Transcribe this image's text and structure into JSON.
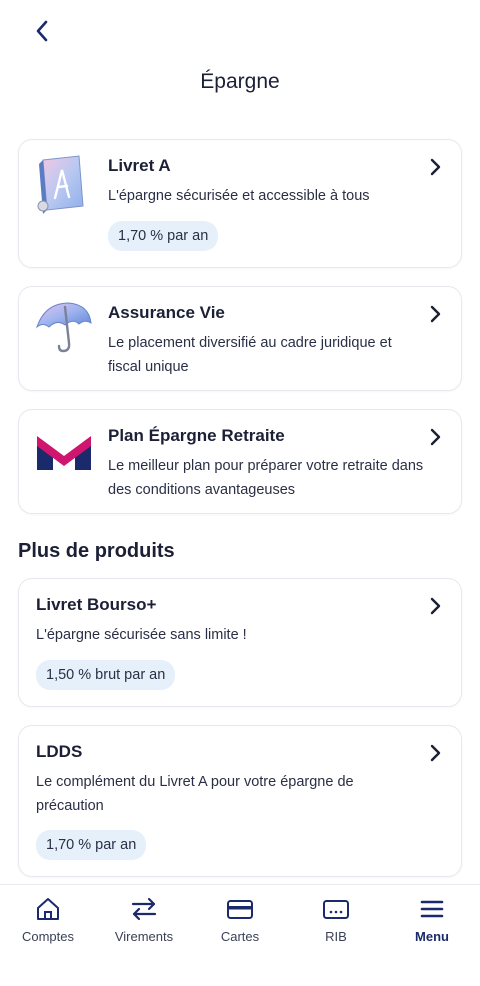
{
  "header": {
    "title": "Épargne"
  },
  "featured": [
    {
      "title": "Livret A",
      "description": "L'épargne sécurisée et accessible à tous",
      "badge": "1,70 % par an",
      "icon": "livret-a-book-icon"
    },
    {
      "title": "Assurance Vie",
      "description": "Le placement diversifié au cadre juridique et fiscal unique",
      "icon": "umbrella-icon"
    },
    {
      "title": "Plan Épargne Retraite",
      "description": "Le meilleur plan pour préparer votre retraite dans des conditions avantageuses",
      "icon": "m-logo-icon"
    }
  ],
  "more_section": {
    "title": "Plus de produits",
    "items": [
      {
        "title": "Livret Bourso+",
        "description": "L'épargne sécurisée sans limite !",
        "badge": "1,50 % brut par an"
      },
      {
        "title": "LDDS",
        "description": "Le complément du Livret A pour votre épargne de précaution",
        "badge": "1,70 % par an"
      }
    ]
  },
  "bottom_nav": [
    {
      "label": "Comptes",
      "icon": "home-icon"
    },
    {
      "label": "Virements",
      "icon": "transfer-arrows-icon"
    },
    {
      "label": "Cartes",
      "icon": "card-icon"
    },
    {
      "label": "RIB",
      "icon": "rib-card-icon"
    },
    {
      "label": "Menu",
      "icon": "menu-icon",
      "active": true
    }
  ],
  "colors": {
    "primary": "#1b2a6b",
    "badge_bg": "#e6f0fb",
    "border": "#e6e8ee",
    "logo_pink": "#d0156f",
    "logo_navy": "#1b2a6b"
  }
}
